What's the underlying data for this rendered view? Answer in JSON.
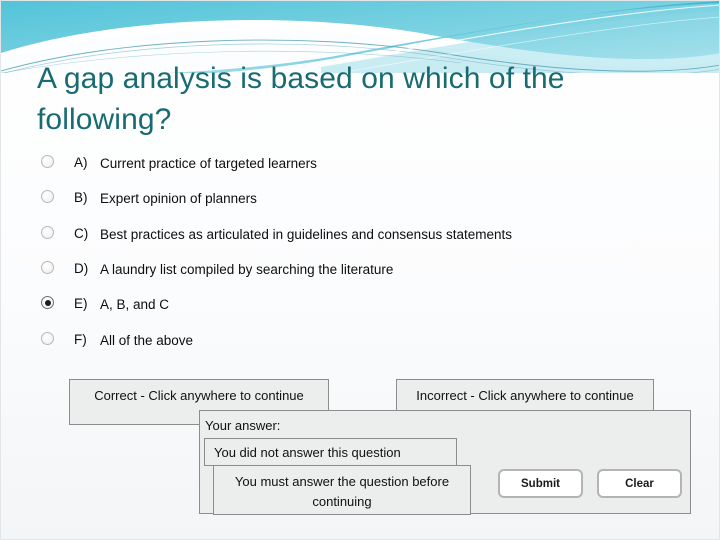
{
  "slide": {
    "title": "A gap analysis is based on which of the following?",
    "background_color": "#ffffff",
    "title_color": "#186b72",
    "banner_color_top": "#54c4d8",
    "banner_color_accent": "#2f9fb8"
  },
  "question": {
    "options": [
      {
        "letter": "A)",
        "text": "Current practice of targeted learners",
        "selected": false
      },
      {
        "letter": "B)",
        "text": "Expert opinion of planners",
        "selected": false
      },
      {
        "letter": "C)",
        "text": "Best practices as articulated in guidelines and consensus statements",
        "selected": false
      },
      {
        "letter": "D)",
        "text": "A laundry list compiled by searching the literature",
        "selected": false
      },
      {
        "letter": "E)",
        "text": "A, B, and C",
        "selected": true
      },
      {
        "letter": "F)",
        "text": "All of the above",
        "selected": false
      }
    ]
  },
  "feedback": {
    "correct_message": "Correct - Click anywhere to continue",
    "incorrect_message": "Incorrect - Click anywhere to continue",
    "your_answer_label": "Your answer:",
    "not_answered_message": "You did not answer this question",
    "must_answer_message": "You must answer the question before continuing"
  },
  "controls": {
    "submit_label": "Submit",
    "clear_label": "Clear"
  }
}
